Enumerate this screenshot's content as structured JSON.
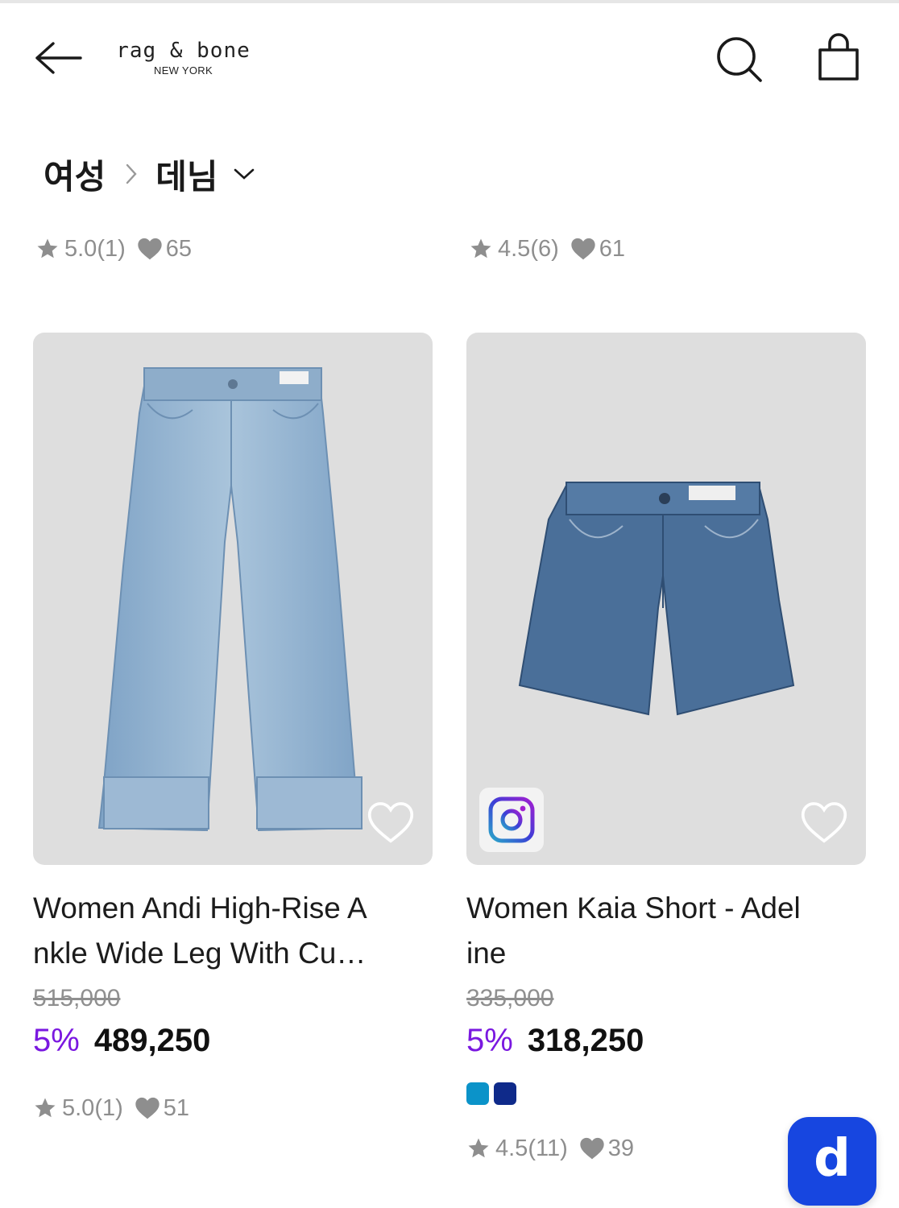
{
  "header": {
    "brand_name": "rag & bone",
    "brand_sub": "NEW YORK",
    "icons": [
      "arrow-left-icon",
      "search-icon",
      "shopping-bag-icon"
    ]
  },
  "breadcrumb": {
    "parent": "여성",
    "current": "데님"
  },
  "top_row_meta": [
    {
      "rating": "5.0(1)",
      "likes": "65"
    },
    {
      "rating": "4.5(6)",
      "likes": "61"
    }
  ],
  "products": [
    {
      "title": "Women Andi High-Rise A nkle Wide Leg With Cu…",
      "original_price": "515,000",
      "discount": "5%",
      "sale_price": "489,250",
      "rating": "5.0(1)",
      "likes": "51",
      "swatches": []
    },
    {
      "title": "Women Kaia Short - Adel ine",
      "original_price": "335,000",
      "discount": "5%",
      "sale_price": "318,250",
      "rating": "4.5(11)",
      "likes": "39",
      "swatches": [
        "#0b93c9",
        "#0f2a8a"
      ]
    }
  ],
  "fab": {
    "label": "d"
  },
  "colors": {
    "discount": "#7a18e0",
    "fab_bg": "#1746e0",
    "muted_text": "#8e8e8e",
    "image_bg": "#dedede"
  }
}
